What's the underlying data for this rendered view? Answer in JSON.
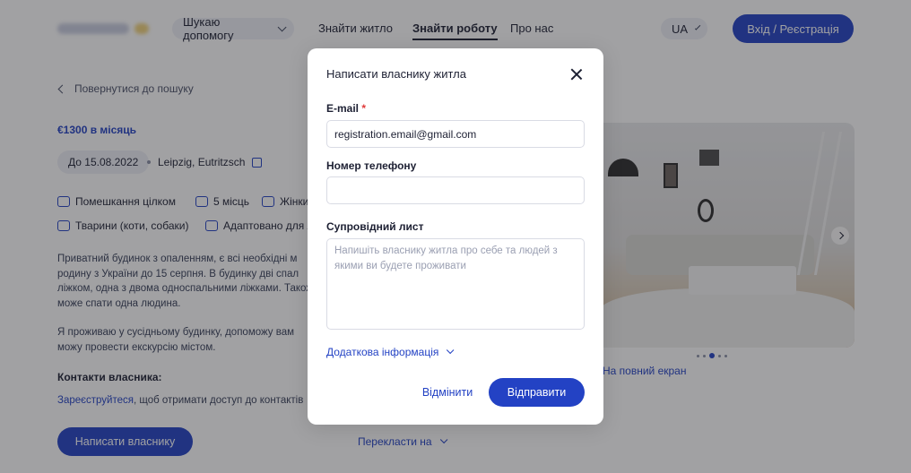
{
  "header": {
    "help_label": "Шукаю допомогу",
    "nav": [
      "Знайти житло",
      "Знайти роботу",
      "Про нас"
    ],
    "lang": "UA",
    "login_label": "Вхід / Реєстрація"
  },
  "listing": {
    "back_label": "Повернутися до пошуку",
    "price": "€1300 в місяць",
    "date": "До 15.08.2022",
    "location": "Leipzig, Eutritzsch",
    "features": [
      "Помешкання цілком",
      "5 місць",
      "Жінки",
      "Тварини (коти, собаки)",
      "Адаптовано для л"
    ],
    "description": [
      "Приватний будинок з опаленням, є всі необхідні м",
      "родину з України до 15 серпня. В будинку дві спал",
      "ліжком, одна з двома односпальними ліжками. Також",
      "може спати одна людина.",
      "Я проживаю у сусідньому будинку, допоможу вам",
      "можу провести екскурсію містом."
    ],
    "contacts_title": "Контакти власника:",
    "contacts_link": "Зареєструйтеся",
    "contacts_text": ", щоб отримати доступ до контактів",
    "write_label": "Написати власнику",
    "translate_label": "Перекласти на",
    "fullscreen_label": "На повний екран",
    "carousel": {
      "count": 5,
      "active": 2
    }
  },
  "modal": {
    "title": "Написати власнику житла",
    "email_label": "E-mail",
    "email_required": "*",
    "email_value": "registration.email@gmail.com",
    "phone_label": "Номер телефону",
    "phone_value": "",
    "letter_label": "Супровідний лист",
    "letter_placeholder": "Напишіть власнику житла про себе та людей з якими ви будете проживати",
    "extra_label": "Додаткова інформація",
    "cancel_label": "Відмінити",
    "send_label": "Відправити"
  },
  "colors": {
    "accent": "#2342c4",
    "required": "#e03a3a",
    "overlay": "rgba(32,32,36,0.42)"
  }
}
